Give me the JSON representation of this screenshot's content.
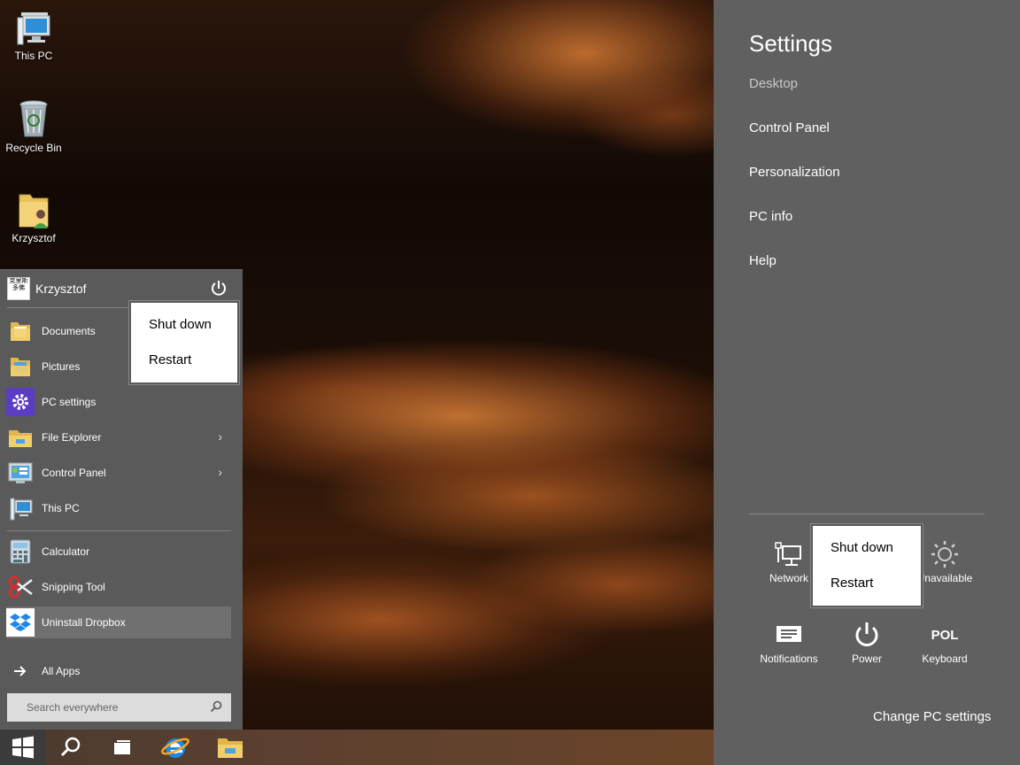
{
  "desktop": {
    "icons": [
      {
        "label": "This PC"
      },
      {
        "label": "Recycle Bin"
      },
      {
        "label": "Krzysztof"
      }
    ]
  },
  "start_menu": {
    "user_name": "Krzysztof",
    "avatar_text": "克里斯多佛",
    "pinned": [
      {
        "label": "Documents"
      },
      {
        "label": "Pictures"
      },
      {
        "label": "PC settings"
      },
      {
        "label": "File Explorer"
      },
      {
        "label": "Control Panel"
      },
      {
        "label": "This PC"
      }
    ],
    "recent": [
      {
        "label": "Calculator"
      },
      {
        "label": "Snipping Tool"
      },
      {
        "label": "Uninstall Dropbox"
      }
    ],
    "all_apps": "All Apps",
    "search_placeholder": "Search everywhere",
    "power_menu": {
      "shut_down": "Shut down",
      "restart": "Restart"
    }
  },
  "settings_charm": {
    "title": "Settings",
    "context": "Desktop",
    "links": [
      "Control Panel",
      "Personalization",
      "PC info",
      "Help"
    ],
    "tiles": {
      "network": "Network",
      "brightness": "Unavailable",
      "notifications": "Notifications",
      "power": "Power",
      "keyboard_code": "POL",
      "keyboard": "Keyboard"
    },
    "power_menu": {
      "shut_down": "Shut down",
      "restart": "Restart"
    },
    "change_pc_settings": "Change PC settings"
  },
  "colors": {
    "charm_bg": "#606060",
    "start_menu_bg": "#5a5a5a",
    "highlight": "#707070",
    "ie_blue": "#1e88e5"
  }
}
